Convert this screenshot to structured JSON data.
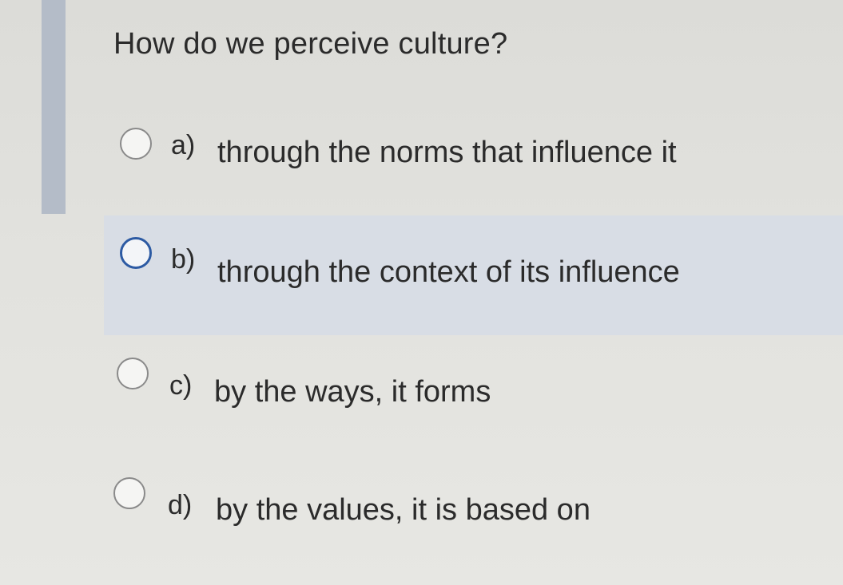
{
  "question": {
    "text": "How do we perceive culture?"
  },
  "options": [
    {
      "letter": "a)",
      "text": "through the norms that influence it"
    },
    {
      "letter": "b)",
      "text": "through the context of its influence"
    },
    {
      "letter": "c)",
      "text": "by the ways, it forms"
    },
    {
      "letter": "d)",
      "text": "by the values, it is based on"
    }
  ],
  "colors": {
    "background": "#e2e2de",
    "accent_bar": "#b4bcc8",
    "highlight_row": "#d8dde5",
    "text": "#2b2b2b",
    "radio_border": "#8a8a8a",
    "radio_focus": "#2c5aa3"
  },
  "icons": {
    "radio": "radio-circle-icon"
  }
}
